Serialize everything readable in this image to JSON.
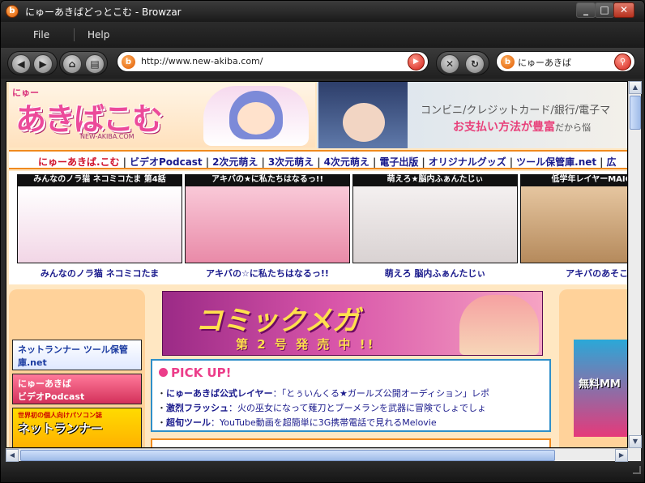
{
  "window": {
    "title": "にゅーあきばどっとこむ - Browzar",
    "app_icon": "browzar-icon"
  },
  "menu": {
    "file": "File",
    "help": "Help"
  },
  "toolbar": {
    "address": "http://www.new-akiba.com/",
    "search_value": "にゅーあきば"
  },
  "page": {
    "logo_small": "にゅー",
    "logo_big": "あきばこむ",
    "logo_url": "NEW-AKIBA.COM",
    "banner_line1": "コンビニ/クレジットカード/銀行/電子マ",
    "banner_line2": "お支払い方法が豊富",
    "banner_line2_tail": "だから悩",
    "nav": [
      "にゅーあきば.こむ",
      "ビデオPodcast",
      "2次元萌え",
      "3次元萌え",
      "4次元萌え",
      "電子出版",
      "オリジナルグッズ",
      "ツール保管庫.net",
      "広"
    ],
    "thumbs": [
      {
        "head": "みんなのノラ猫 ネコミコたま 第4話",
        "caption": "みんなのノラ猫 ネコミコたま",
        "color": "#f7e8f0"
      },
      {
        "head": "アキバの★に私たちはなるっ!!",
        "caption": "アキバの☆に私たちはなるっ!!",
        "color": "#f4b8cc"
      },
      {
        "head": "萌えろ★脳内ふぁんたじぃ",
        "caption": "萌えろ 脳内ふぁんたじぃ",
        "color": "#e9e4e4"
      },
      {
        "head": "低学年レイヤーMAICOのア",
        "caption": "アキバのあそこ 低",
        "color": "#d8b48a"
      }
    ],
    "side": {
      "btn1": "ネットランナー ツール保管庫.net",
      "btn2_line1": "にゅーあきば",
      "btn2_line2": "ビデオPodcast",
      "btn3_small": "世界初の個人向けパソコン誌",
      "btn3_big": "ネットランナー"
    },
    "magazine": {
      "title": "コミックメガ",
      "sub": "第 2 号 発 売 中 !!"
    },
    "pickup": {
      "title": "PICK UP!",
      "items": [
        {
          "head": "にゅーあきば公式レイヤー",
          "text": "：「とぅいんくる★ガールズ公開オーディション」レポ"
        },
        {
          "head": "激烈フラッシュ",
          "text": "：火の巫女になって薙刀とブーメランを武器に冒険でしょでしょ"
        },
        {
          "head": "超旬ツール",
          "text": "：YouTube動画を超簡単に3G携帯電話で見れるMelovie"
        }
      ]
    },
    "right_ad": "無料MM"
  }
}
